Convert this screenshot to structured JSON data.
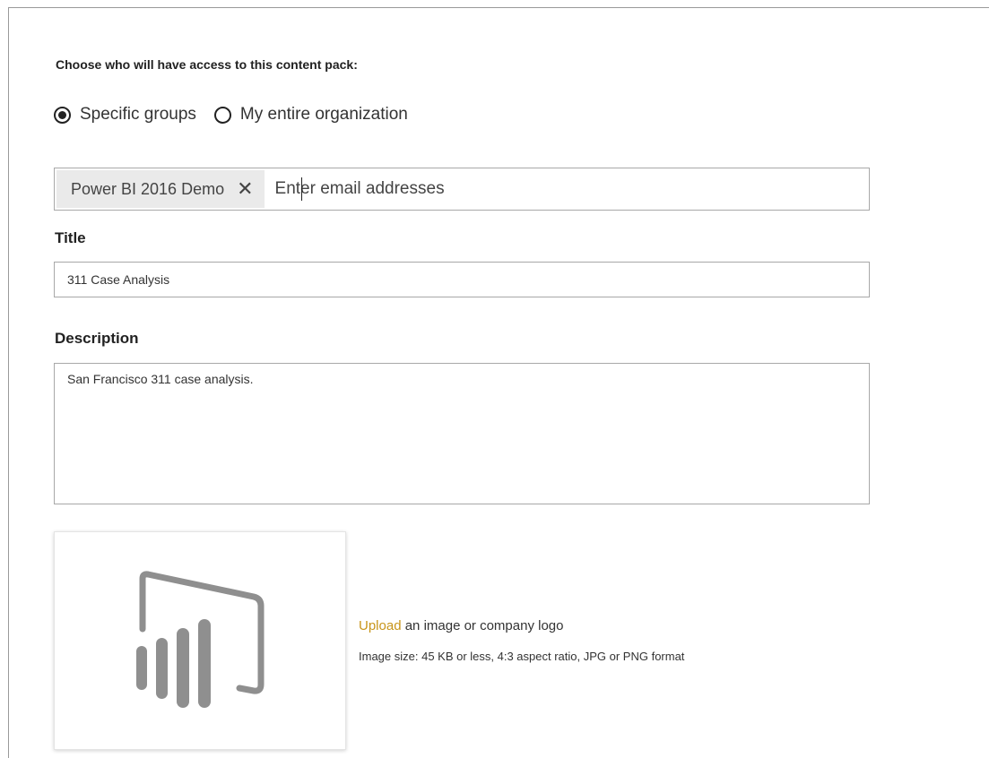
{
  "access": {
    "heading": "Choose who will have access to this content pack:",
    "options": [
      {
        "label": "Specific groups",
        "selected": true
      },
      {
        "label": "My entire organization",
        "selected": false
      }
    ]
  },
  "recipients": {
    "chips": [
      "Power BI 2016 Demo"
    ],
    "remove_symbol": "✕",
    "placeholder": "Enter email addresses"
  },
  "title": {
    "label": "Title",
    "value": "311 Case Analysis"
  },
  "description": {
    "label": "Description",
    "value": "San Francisco 311 case analysis."
  },
  "image": {
    "placeholder_icon": "power-bi-logo-icon",
    "upload_link": "Upload",
    "upload_text": " an image or company logo",
    "size_note": "Image size: 45 KB or less, 4:3 aspect ratio, JPG or PNG format"
  },
  "colors": {
    "link": "#c8951a",
    "logo_gray": "#8f8f8f",
    "border": "#a8a8a8"
  }
}
